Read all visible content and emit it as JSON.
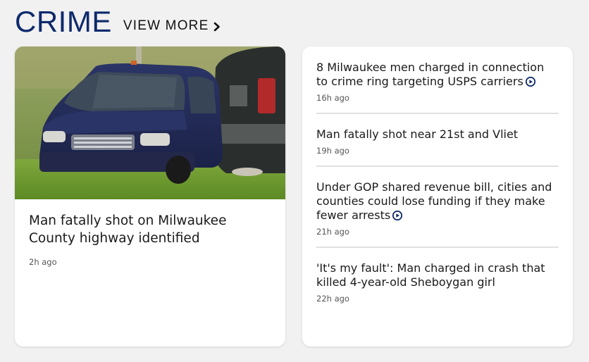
{
  "section": {
    "title": "CRIME",
    "view_more_label": "VIEW MORE",
    "accent_color": "#0d2a6b"
  },
  "featured": {
    "headline": "Man fatally shot on Milwaukee County highway identified",
    "timestamp": "2h ago",
    "image_icon": "minivan-photo"
  },
  "stories": [
    {
      "headline": "8 Milwaukee men charged in connection to crime ring targeting USPS carriers",
      "timestamp": "16h ago",
      "has_video": true
    },
    {
      "headline": "Man fatally shot near 21st and Vliet",
      "timestamp": "19h ago",
      "has_video": false
    },
    {
      "headline": "Under GOP shared revenue bill, cities and counties could lose funding if they make fewer arrests",
      "timestamp": "21h ago",
      "has_video": true
    },
    {
      "headline": "'It's my fault': Man charged in crash that killed 4-year-old Sheboygan girl",
      "timestamp": "22h ago",
      "has_video": false
    }
  ]
}
